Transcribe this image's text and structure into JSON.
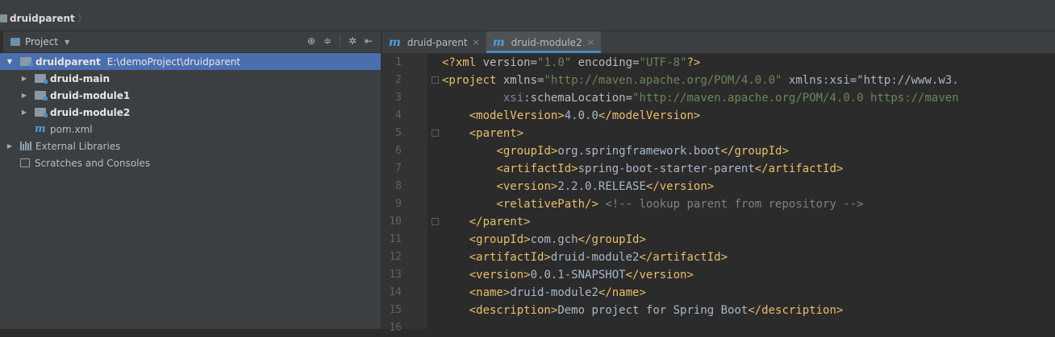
{
  "breadcrumb": {
    "label": "druidparent"
  },
  "project_panel": {
    "title": "Project",
    "tree": [
      {
        "id": "root",
        "label": "druidparent",
        "path": "E:\\demoProject\\druidparent",
        "selected": true,
        "expanded": true
      },
      {
        "id": "druid-main",
        "label": "druid-main"
      },
      {
        "id": "druid-module1",
        "label": "druid-module1"
      },
      {
        "id": "druid-module2",
        "label": "druid-module2"
      },
      {
        "id": "pom",
        "label": "pom.xml",
        "icon": "maven-m-icon"
      },
      {
        "id": "ext",
        "label": "External Libraries",
        "icon": "library-icon"
      },
      {
        "id": "scratch",
        "label": "Scratches and Consoles",
        "icon": "scratch-icon"
      }
    ]
  },
  "editor": {
    "tabs": [
      {
        "label": "druid-parent",
        "active": false
      },
      {
        "label": "druid-module2",
        "active": true
      }
    ],
    "close_glyph": "×",
    "lines": [
      {
        "n": "1",
        "text": "<?xml version=\"1.0\" encoding=\"UTF-8\"?>"
      },
      {
        "n": "2",
        "text": "<project xmlns=\"http://maven.apache.org/POM/4.0.0\" xmlns:xsi=\"http://www.w3."
      },
      {
        "n": "3",
        "text": "         xsi:schemaLocation=\"http://maven.apache.org/POM/4.0.0 https://maven"
      },
      {
        "n": "4",
        "text": "    <modelVersion>4.0.0</modelVersion>"
      },
      {
        "n": "5",
        "text": "    <parent>"
      },
      {
        "n": "6",
        "text": "        <groupId>org.springframework.boot</groupId>"
      },
      {
        "n": "7",
        "text": "        <artifactId>spring-boot-starter-parent</artifactId>"
      },
      {
        "n": "8",
        "text": "        <version>2.2.0.RELEASE</version>"
      },
      {
        "n": "9",
        "text": "        <relativePath/> <!-- lookup parent from repository -->"
      },
      {
        "n": "10",
        "text": "    </parent>"
      },
      {
        "n": "11",
        "text": "    <groupId>com.gch</groupId>"
      },
      {
        "n": "12",
        "text": "    <artifactId>druid-module2</artifactId>"
      },
      {
        "n": "13",
        "text": "    <version>0.0.1-SNAPSHOT</version>"
      },
      {
        "n": "14",
        "text": "    <name>druid-module2</name>"
      },
      {
        "n": "15",
        "text": "    <description>Demo project for Spring Boot</description>"
      },
      {
        "n": "16",
        "text": ""
      }
    ]
  },
  "colors": {
    "selection": "#4b6eaf",
    "tag": "#e8bf6a",
    "attr_value": "#6a8759",
    "namespace": "#9876aa",
    "comment": "#808080",
    "accent_tab": "#4a88c7"
  }
}
